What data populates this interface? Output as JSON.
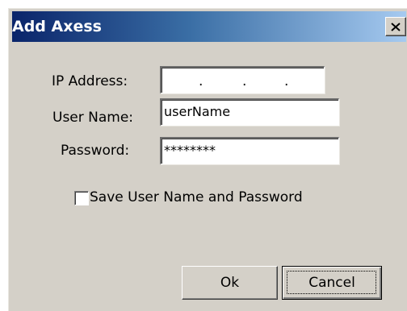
{
  "window": {
    "title": "Add Axess",
    "close_glyph": "X"
  },
  "form": {
    "ip_label": "IP Address:",
    "ip_value": [
      "",
      "",
      "",
      ""
    ],
    "ip_separators": [
      ".",
      ".",
      "."
    ],
    "username_label": "User Name:",
    "username_value": "userName",
    "password_label": "Password:",
    "password_value": "********",
    "save_checkbox_label": "Save User Name and Password",
    "save_checked": false
  },
  "buttons": {
    "ok_label": "Ok",
    "cancel_label": "Cancel"
  },
  "colors": {
    "dialog_bg": "#d4d0c8",
    "title_start": "#0a246a",
    "title_end": "#a6caf0",
    "title_text": "#ffffff"
  },
  "icons": {
    "close": "close-icon"
  }
}
